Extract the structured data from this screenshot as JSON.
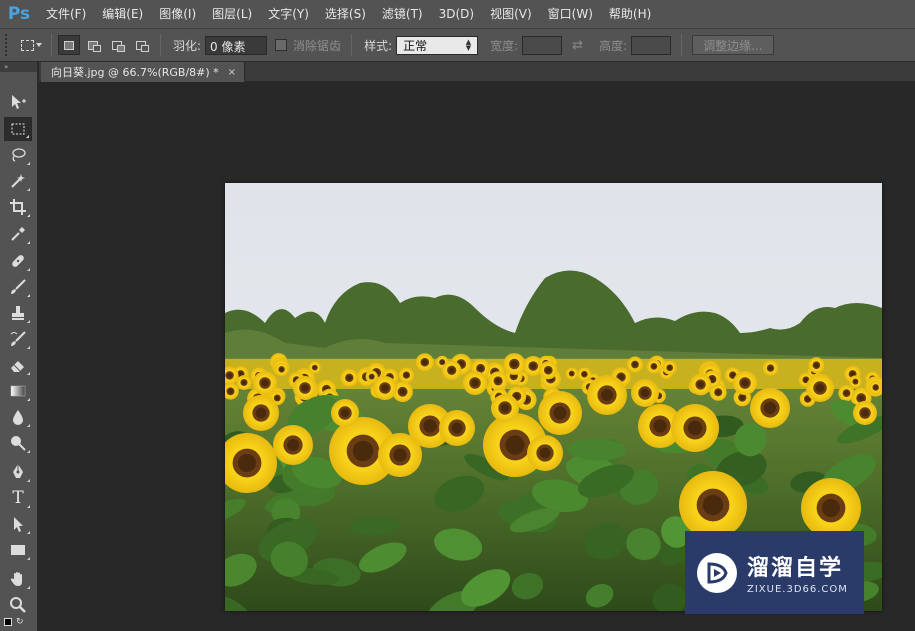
{
  "app": {
    "logo": "Ps"
  },
  "menu": [
    "文件(F)",
    "编辑(E)",
    "图像(I)",
    "图层(L)",
    "文字(Y)",
    "选择(S)",
    "滤镜(T)",
    "3D(D)",
    "视图(V)",
    "窗口(W)",
    "帮助(H)"
  ],
  "options": {
    "feather_label": "羽化:",
    "feather_value": "0 像素",
    "antialias_label": "消除锯齿",
    "style_label": "样式:",
    "style_value": "正常",
    "width_label": "宽度:",
    "height_label": "高度:",
    "refine_button": "调整边缘..."
  },
  "toolbar": {
    "collapse_glyph": "»",
    "tools": [
      "move-icon",
      "rect-marquee-icon",
      "lasso-icon",
      "magic-wand-icon",
      "crop-icon",
      "eyedropper-icon",
      "healing-brush-icon",
      "brush-icon",
      "clone-stamp-icon",
      "history-brush-icon",
      "eraser-icon",
      "gradient-icon",
      "blur-icon",
      "dodge-icon",
      "pen-icon",
      "type-icon",
      "path-select-icon",
      "rectangle-shape-icon",
      "hand-icon",
      "zoom-icon"
    ],
    "type_tool_glyph": "T"
  },
  "document": {
    "tab_title": "向日葵.jpg @ 66.7%(RGB/8#) *",
    "close_glyph": "×"
  },
  "watermark": {
    "title": "溜溜自学",
    "subtitle": "ZIXUE.3D66.COM"
  },
  "colors": {
    "ui_panel": "#535353",
    "canvas_bg": "#282828",
    "ps_blue": "#4aa3df",
    "watermark_bg": "#2a3b6a"
  }
}
